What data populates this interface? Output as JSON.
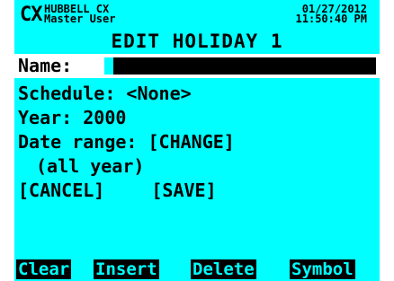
{
  "header": {
    "logo": "CX",
    "brand_line1": "HUBBELL CX",
    "brand_line2": "Master User",
    "date": "01/27/2012",
    "time": "11:50:40 PM"
  },
  "title": "EDIT HOLIDAY 1",
  "form": {
    "name_label": "Name:",
    "name_value": "",
    "schedule_label": "Schedule: <None>",
    "year_label": "Year: 2000",
    "date_range_label": "Date range: [CHANGE]",
    "date_range_value": "(all year)",
    "cancel_label": "[CANCEL]",
    "save_label": "[SAVE]"
  },
  "softkeys": [
    "Clear",
    "Insert",
    "Delete",
    "Symbol"
  ]
}
